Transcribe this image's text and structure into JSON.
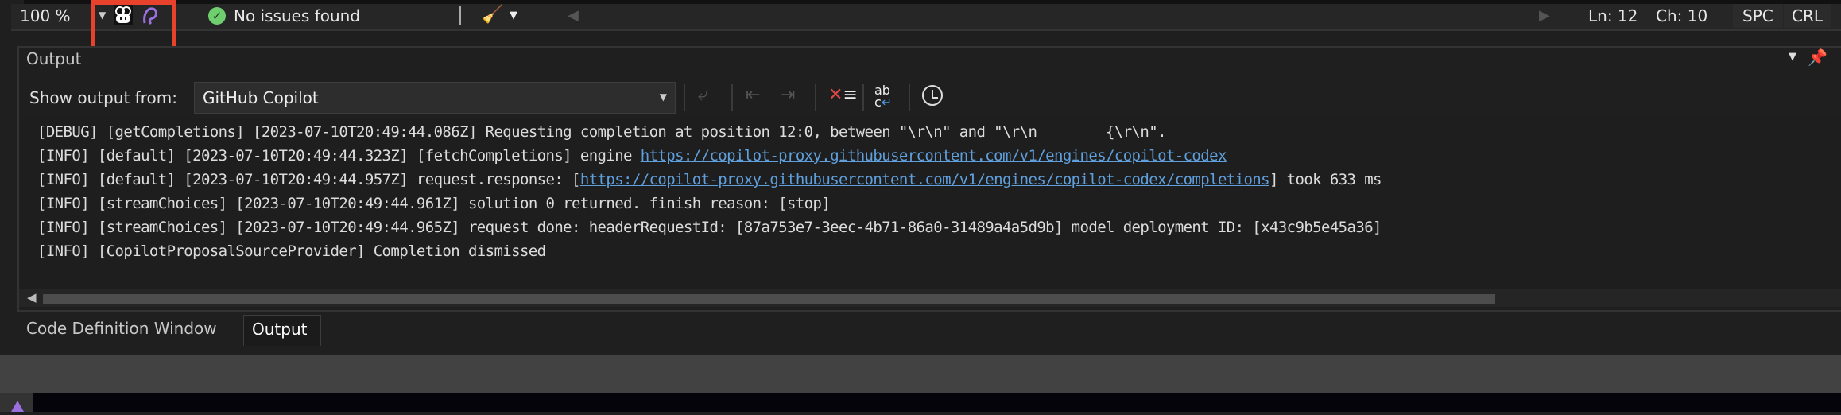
{
  "statusbar": {
    "zoom": "100 %",
    "issues": "No issues found",
    "line": "Ln: 12",
    "char": "Ch: 10",
    "spacing": "SPC",
    "line_ending": "CRL"
  },
  "output_panel": {
    "title": "Output",
    "show_output_label": "Show output from:",
    "source": "GitHub Copilot",
    "lines": [
      {
        "pre": "[DEBUG] [getCompletions] [2023-07-10T20:49:44.086Z] Requesting completion at position 12:0, between \"\\r\\n\" and \"\\r\\n        {\\r\\n\".",
        "link": "",
        "post": ""
      },
      {
        "pre": "[INFO] [default] [2023-07-10T20:49:44.323Z] [fetchCompletions] engine ",
        "link": "https://copilot-proxy.githubusercontent.com/v1/engines/copilot-codex",
        "post": ""
      },
      {
        "pre": "[INFO] [default] [2023-07-10T20:49:44.957Z] request.response: [",
        "link": "https://copilot-proxy.githubusercontent.com/v1/engines/copilot-codex/completions",
        "post": "] took 633 ms"
      },
      {
        "pre": "[INFO] [streamChoices] [2023-07-10T20:49:44.961Z] solution 0 returned. finish reason: [stop]",
        "link": "",
        "post": ""
      },
      {
        "pre": "[INFO] [streamChoices] [2023-07-10T20:49:44.965Z] request done: headerRequestId: [87a753e7-3eec-4b71-86a0-31489a4a5d9b] model deployment ID: [x43c9b5e45a36]",
        "link": "",
        "post": ""
      },
      {
        "pre": "[INFO] [CopilotProposalSourceProvider] Completion dismissed",
        "link": "",
        "post": ""
      }
    ]
  },
  "tabs": [
    {
      "label": "Code Definition Window",
      "active": false
    },
    {
      "label": "Output",
      "active": true
    }
  ],
  "colors": {
    "highlight_box": "#e8412c",
    "link": "#5f9fdc",
    "success": "#6fcf6f"
  }
}
